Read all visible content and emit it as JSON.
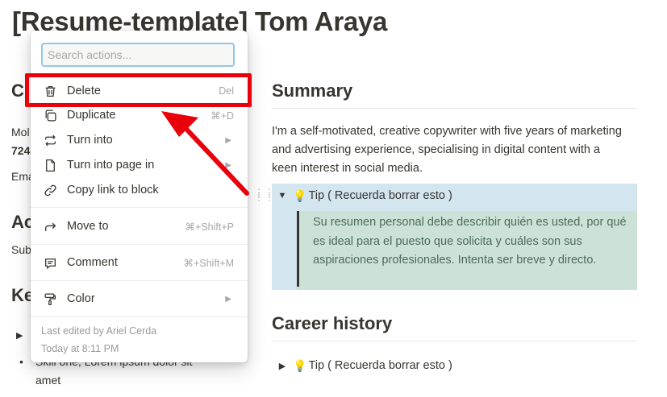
{
  "page": {
    "title": "[Resume-template] Tom Araya"
  },
  "left_column": {
    "heading_contact": "C",
    "mobile_label": "Mol",
    "mobile_value": "724",
    "email_label": "Ema",
    "heading_achievements": "Ac",
    "achievements_text": "Sub",
    "heading_skills": "Ke",
    "skill_bullet": "Skill one, Lorem ipsum dolor sit",
    "skill_bullet_cont": "amet"
  },
  "summary": {
    "heading": "Summary",
    "text": "I'm a self-motivated, creative copywriter with five years of marketing and advertising experience, specialising in digital content with a keen interest in social media.",
    "tip_label": "Tip ( Recuerda borrar esto )",
    "tip_body": "Su resumen personal debe describir quién es usted, por qué es ideal para el puesto que solicita y cuáles son sus aspiraciones profesionales. Intenta ser breve y directo."
  },
  "career": {
    "heading": "Career history",
    "tip_label": "Tip ( Recuerda borrar esto )"
  },
  "menu": {
    "search_placeholder": "Search actions...",
    "items": [
      {
        "label": "Delete",
        "shortcut": "Del",
        "icon": "trash-icon"
      },
      {
        "label": "Duplicate",
        "shortcut": "⌘+D",
        "icon": "duplicate-icon"
      },
      {
        "label": "Turn into",
        "shortcut": "▶",
        "icon": "turn-into-icon"
      },
      {
        "label": "Turn into page in",
        "shortcut": "▶",
        "icon": "page-icon"
      },
      {
        "label": "Copy link to block",
        "shortcut": "",
        "icon": "link-icon"
      },
      {
        "label": "Move to",
        "shortcut": "⌘+Shift+P",
        "icon": "move-arrow-icon"
      },
      {
        "label": "Comment",
        "shortcut": "⌘+Shift+M",
        "icon": "comment-icon"
      },
      {
        "label": "Color",
        "shortcut": "▶",
        "icon": "paint-roller-icon"
      }
    ],
    "footer_edited": "Last edited by Ariel Cerda",
    "footer_time": "Today at 8:11 PM"
  },
  "colors": {
    "annotation_red": "#e8000b",
    "toggle_bg": "#d3e5ef",
    "quote_bg": "#cde2d6",
    "search_focus": "#93c6e9"
  }
}
